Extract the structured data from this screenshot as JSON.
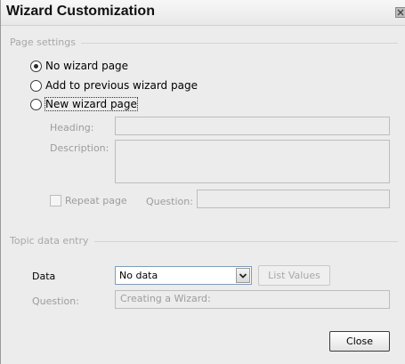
{
  "window": {
    "title": "Wizard Customization"
  },
  "page_settings": {
    "group_label": "Page settings",
    "options": [
      {
        "label": "No wizard page",
        "checked": true
      },
      {
        "label": "Add to previous wizard page",
        "checked": false
      },
      {
        "label": "New wizard page",
        "checked": false
      }
    ],
    "heading_label": "Heading:",
    "heading_value": "",
    "description_label": "Description:",
    "description_value": "",
    "repeat_page_label": "Repeat page",
    "question_label": "Question:",
    "question_value": ""
  },
  "topic_data_entry": {
    "group_label": "Topic data entry",
    "data_label": "Data",
    "data_selected": "No data",
    "list_values_label": "List Values",
    "question_label": "Question:",
    "question_value": "Creating a Wizard:"
  },
  "footer": {
    "close_label": "Close"
  },
  "icons": {
    "close": "close-icon",
    "dropdown": "chevron-down-icon"
  }
}
